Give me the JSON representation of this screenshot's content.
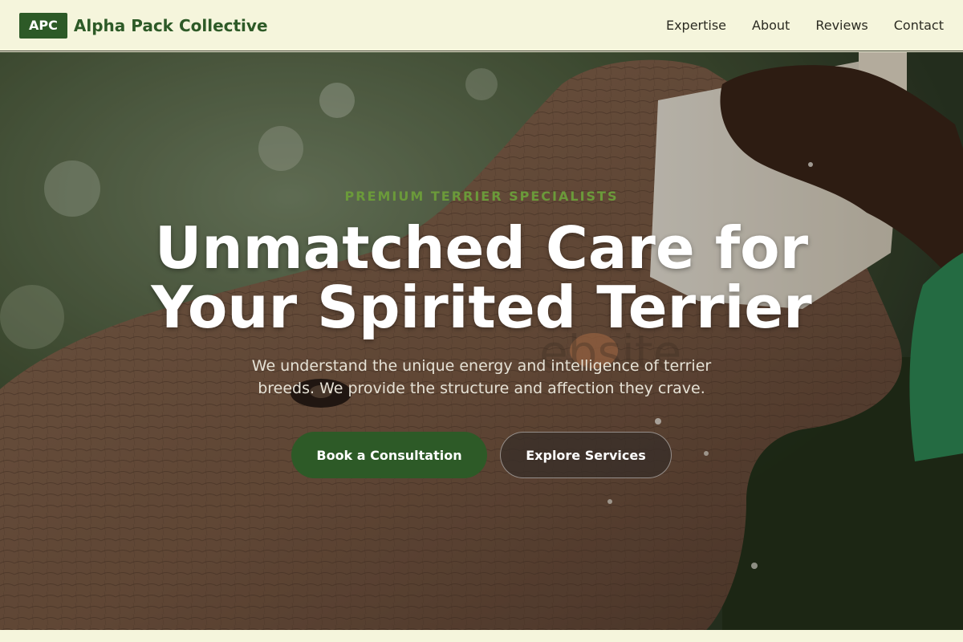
{
  "header": {
    "logo_badge": "APC",
    "brand_name": "Alpha Pack Collective",
    "nav": [
      {
        "label": "Expertise"
      },
      {
        "label": "About"
      },
      {
        "label": "Reviews"
      },
      {
        "label": "Contact"
      }
    ]
  },
  "hero": {
    "eyebrow": "PREMIUM TERRIER SPECIALISTS",
    "headline": "Unmatched Care for Your Spirited Terrier",
    "subheadline": "We understand the unique energy and intelligence of terrier breeds. We provide the structure and affection they crave.",
    "watermark": "ebsite",
    "primary_cta": "Book a Consultation",
    "secondary_cta": "Explore Services",
    "background_image": "elephant-being-bottle-fed"
  },
  "colors": {
    "brand_green": "#2d5a27",
    "eyebrow_green": "#6b9a3a",
    "header_background": "#f5f5dc",
    "headline_text": "#ffffff"
  }
}
